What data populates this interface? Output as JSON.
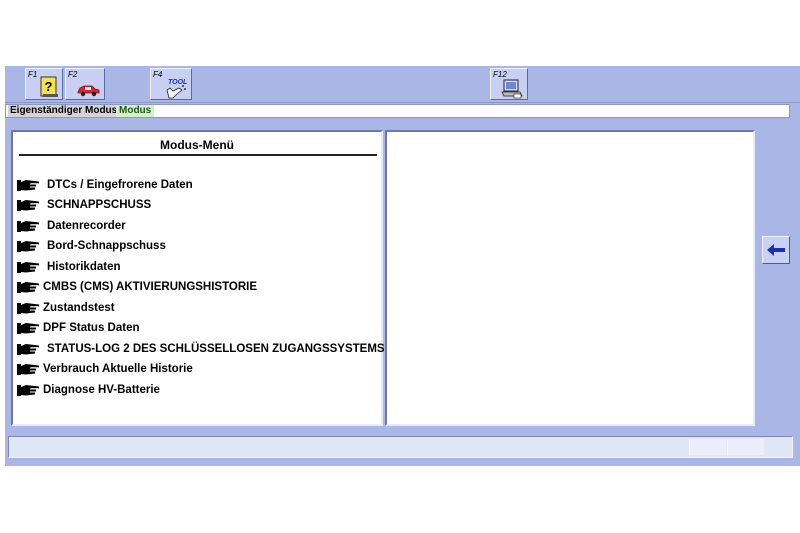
{
  "toolbar": {
    "f1": {
      "key": "F1",
      "icon": "help-question-icon"
    },
    "f2": {
      "key": "F2",
      "icon": "car-icon"
    },
    "f4": {
      "key": "F4",
      "icon": "tool-icon",
      "text": "TOOL"
    },
    "f12": {
      "key": "F12",
      "icon": "print-screen-icon"
    }
  },
  "modebar": {
    "mode": "Eigenständiger Modus",
    "sub": "Modus"
  },
  "menu": {
    "title": "Modus-Menü",
    "items": [
      {
        "label": "DTCs / Eingefrorene Daten"
      },
      {
        "label": "SCHNAPPSCHUSS"
      },
      {
        "label": "Datenrecorder"
      },
      {
        "label": "Bord-Schnappschuss"
      },
      {
        "label": "Historikdaten"
      },
      {
        "label": "CMBS (CMS) AKTIVIERUNGSHISTORIE"
      },
      {
        "label": "Zustandstest"
      },
      {
        "label": "DPF Status Daten"
      },
      {
        "label": "STATUS-LOG 2 DES SCHLÜSSELLOSEN ZUGANGSSYSTEMS"
      },
      {
        "label": "Verbrauch Aktuelle Historie"
      },
      {
        "label": "Diagnose HV-Batterie"
      }
    ]
  },
  "back_button": {
    "icon": "arrow-left-icon"
  },
  "colors": {
    "app_bg": "#a9b6e6",
    "accent_arrow": "#1c2fb4",
    "mode_highlight": "#d7f0c8"
  }
}
